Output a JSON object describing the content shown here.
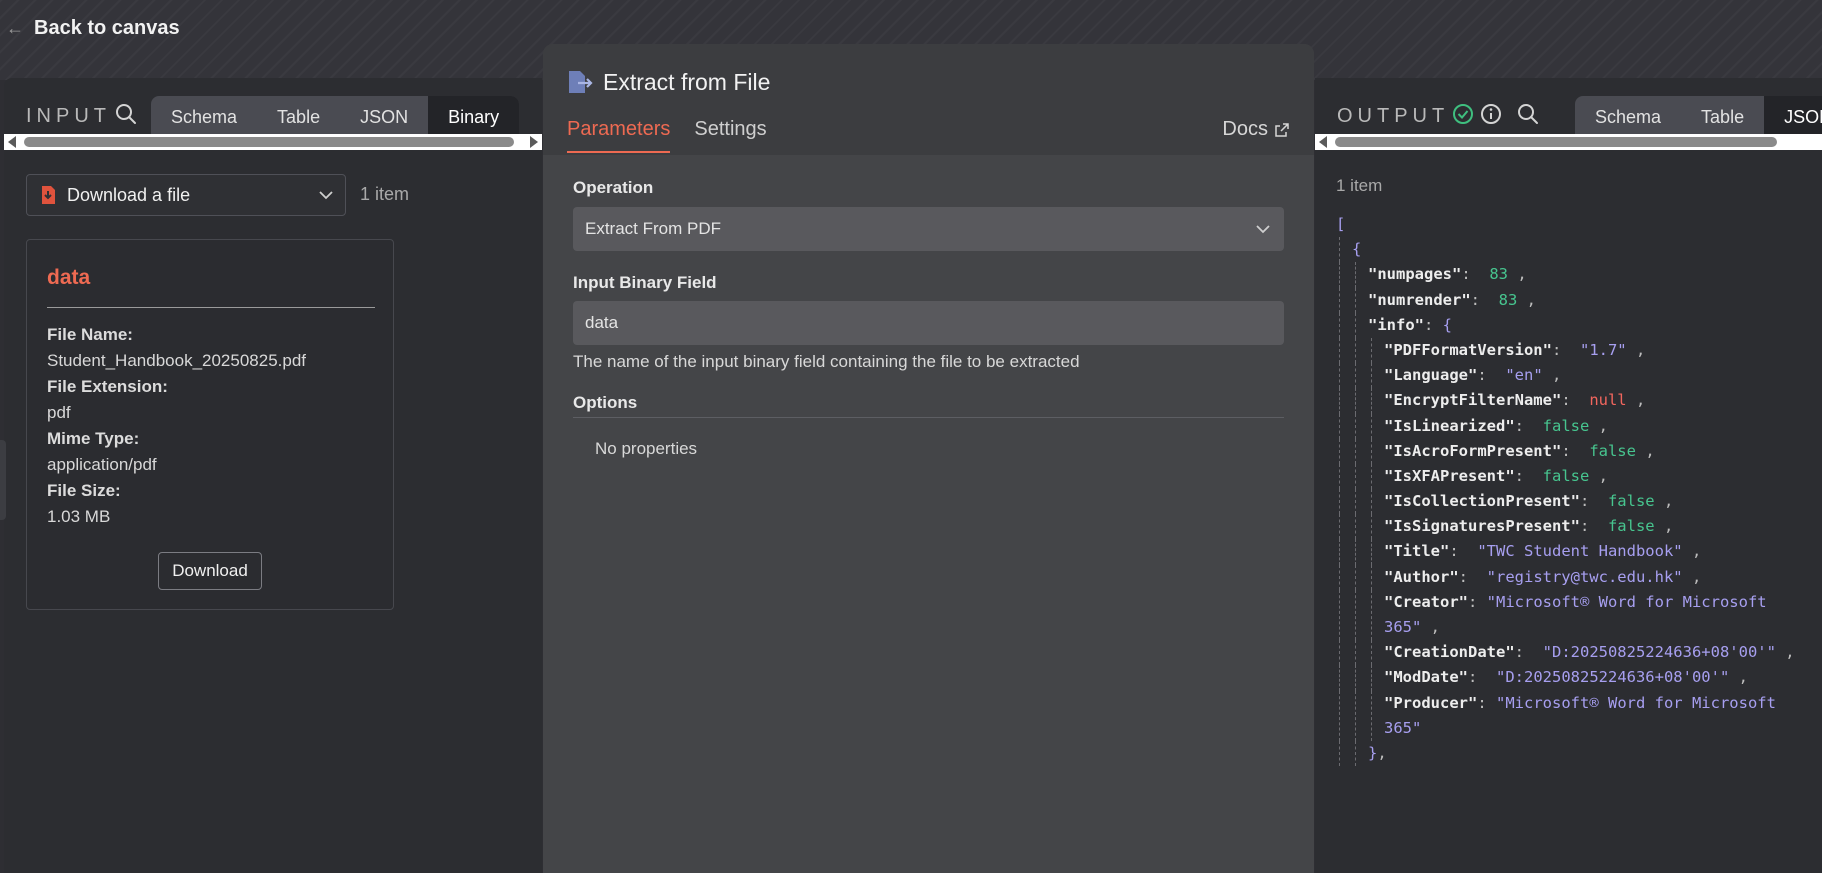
{
  "back": {
    "label": "Back to canvas"
  },
  "input": {
    "label": "INPUT",
    "tabs": [
      "Schema",
      "Table",
      "JSON",
      "Binary"
    ],
    "active_tab": "Binary",
    "node_select": "Download a file",
    "item_count": "1 item",
    "binary": {
      "title": "data",
      "fields": [
        {
          "key": "File Name:",
          "value": "Student_Handbook_20250825.pdf"
        },
        {
          "key": "File Extension:",
          "value": "pdf"
        },
        {
          "key": "Mime Type:",
          "value": "application/pdf"
        },
        {
          "key": "File Size:",
          "value": "1.03 MB"
        }
      ],
      "download_label": "Download"
    }
  },
  "modal": {
    "title": "Extract from File",
    "tabs": [
      "Parameters",
      "Settings"
    ],
    "active_tab": "Parameters",
    "docs_label": "Docs",
    "operation": {
      "label": "Operation",
      "value": "Extract From PDF"
    },
    "binary_field": {
      "label": "Input Binary Field",
      "value": "data",
      "hint": "The name of the input binary field containing the file to be extracted"
    },
    "options": {
      "label": "Options",
      "empty": "No properties"
    }
  },
  "output": {
    "label": "OUTPUT",
    "tabs": [
      "Schema",
      "Table",
      "JSON"
    ],
    "active_tab": "JSON",
    "item_count": "1 item",
    "json": {
      "numpages": "83",
      "numrender": "83",
      "info": {
        "PDFFormatVersion": "\"1.7\"",
        "Language": "\"en\"",
        "EncryptFilterName": "null",
        "IsLinearized": "false",
        "IsAcroFormPresent": "false",
        "IsXFAPresent": "false",
        "IsCollectionPresent": "false",
        "IsSignaturesPresent": "false",
        "Title": "\"TWC Student Handbook\"",
        "Author": "\"registry@twc.edu.hk\"",
        "Creator": "\"Microsoft® Word for Microsoft 365\"",
        "CreationDate": "\"D:20250825224636+08'00'\"",
        "ModDate": "\"D:20250825224636+08'00'\"",
        "Producer": "\"Microsoft® Word for Microsoft 365\""
      }
    }
  },
  "colors": {
    "accent": "#ee6a52",
    "json_string": "#a79ff0",
    "json_number": "#47c58f",
    "json_null": "#f2665e",
    "success": "#3fbf7f"
  }
}
